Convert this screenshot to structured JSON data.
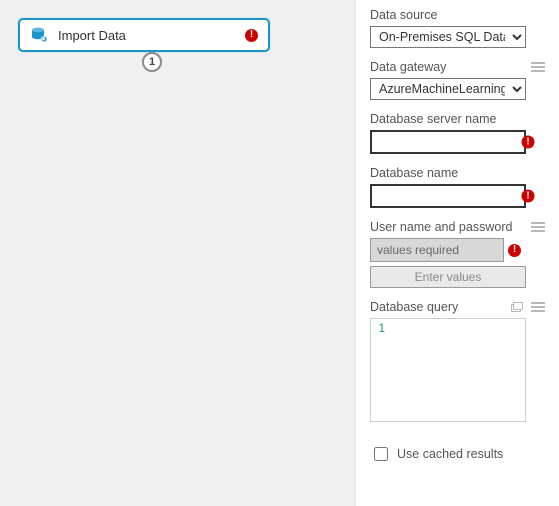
{
  "module": {
    "title": "Import Data",
    "port_label": "1"
  },
  "properties": {
    "data_source_label": "Data source",
    "data_source_value": "On-Premises SQL Database",
    "data_gateway_label": "Data gateway",
    "data_gateway_value": "AzureMachineLearning_On",
    "db_server_label": "Database server name",
    "db_server_value": "",
    "db_name_label": "Database name",
    "db_name_value": "",
    "credentials_label": "User name and password",
    "credentials_placeholder": "values required",
    "enter_values_label": "Enter values",
    "query_label": "Database query",
    "query_value": "",
    "query_line_no": "1",
    "use_cached_label": "Use cached results",
    "use_cached_checked": false
  },
  "colors": {
    "module_border": "#1a94c9",
    "error": "#cc0000"
  }
}
